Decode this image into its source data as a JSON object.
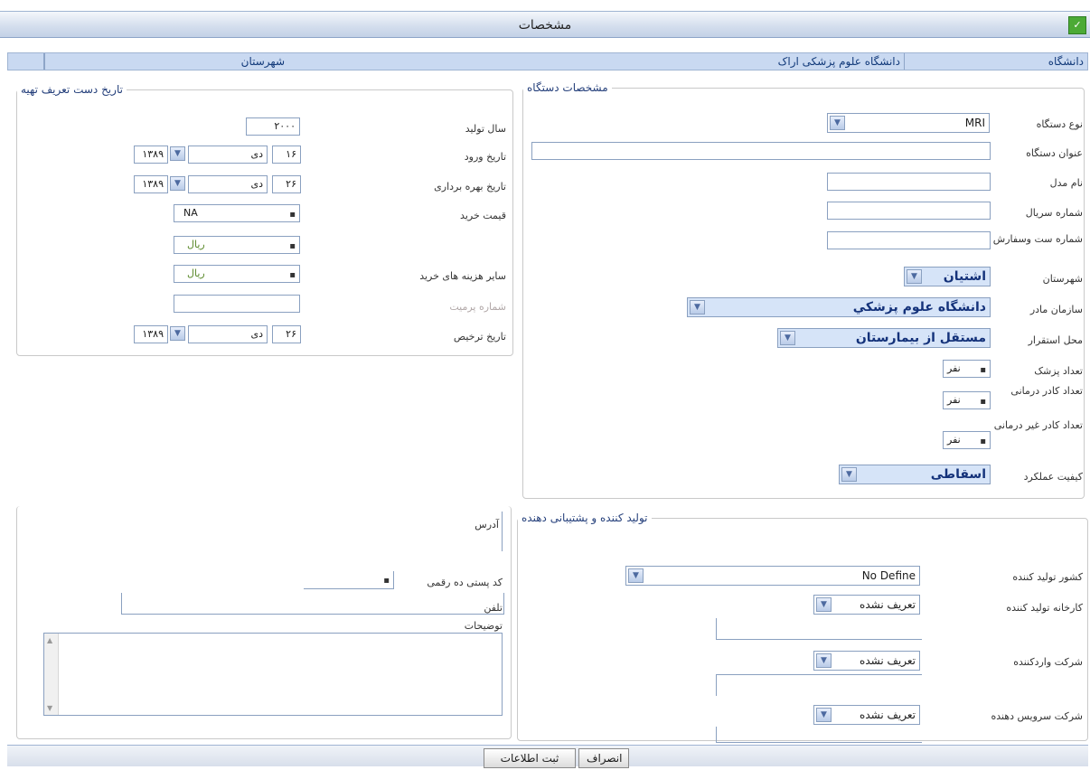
{
  "window": {
    "title": "مشخصات"
  },
  "infobar": {
    "university_label": "دانشگاه",
    "university_value": "دانشگاه علوم پزشکی اراک",
    "city_label": "شهرستان"
  },
  "device_group": {
    "legend": "مشخصات دستگاه",
    "fields": {
      "device_type": {
        "label": "نوع دستگاه",
        "value": "MRI"
      },
      "device_title": {
        "label": "عنوان دستگاه",
        "value": ""
      },
      "model_name": {
        "label": "نام مدل",
        "value": ""
      },
      "serial_number": {
        "label": "شماره سریال",
        "value": ""
      },
      "order_number": {
        "label": "شماره ست وسفارش",
        "value": ""
      },
      "city": {
        "label": "شهرستان",
        "value": "اشتیان"
      },
      "parent_org": {
        "label": "سازمان مادر",
        "value": "دانشگاه علوم پزشکي"
      },
      "location": {
        "label": "محل استقرار",
        "value": "مستقل از بيمارستان"
      },
      "doctor_count": {
        "label": "تعداد پزشک",
        "value": "نفر"
      },
      "medical_staff": {
        "label": "تعداد کادر درمانی",
        "value": "نفر"
      },
      "nonmedical_staff": {
        "label": "تعداد کادر غیر درمانی",
        "value": "نفر"
      },
      "condition": {
        "label": "کیفیت عملکرد",
        "value": "اسقاطی"
      }
    }
  },
  "purchase_group": {
    "legend": "تاریخ دست تعریف تهیه",
    "fields": {
      "year_made": {
        "label": "سال تولید",
        "value": "۲۰۰۰"
      },
      "entry_date": {
        "label": "تاریخ ورود",
        "day": "۱۶",
        "month": "دی",
        "year": "۱۳۸۹"
      },
      "operation_date": {
        "label": "تاریخ بهره برداری",
        "day": "۲۶",
        "month": "دی",
        "year": "۱۳۸۹"
      },
      "price": {
        "label": "قیمت خرید",
        "value": "NA"
      },
      "price2": {
        "value": "ریال"
      },
      "maintenance_cost": {
        "label": "سایر هزینه های خرید",
        "value": "ریال"
      },
      "license_number": {
        "label": "شماره پرمیت",
        "value": ""
      },
      "license_date": {
        "label": "تاریخ ترخیص",
        "day": "۲۶",
        "month": "دی",
        "year": "۱۳۸۹"
      }
    }
  },
  "supplier_group": {
    "legend": "تولید کننده و پشتیبانی دهنده",
    "fields": {
      "maker_country": {
        "label": "کشور تولید کننده",
        "value": "No Define"
      },
      "maker_company": {
        "label": "کارخانه تولید کننده",
        "value": "تعریف نشده"
      },
      "importer": {
        "label": "شرکت واردکننده",
        "value": "تعریف نشده"
      },
      "service_company": {
        "label": "شرکت سرویس دهنده",
        "value": "تعریف نشده"
      }
    }
  },
  "contact_group": {
    "address_label": "آدرس",
    "postal_code_label": "کد پستی ده رقمی",
    "phone_label": "تلفن",
    "notes_label": "توضیحات"
  },
  "buttons": {
    "submit": "ثبت اطلاعات",
    "cancel": "انصراف"
  }
}
